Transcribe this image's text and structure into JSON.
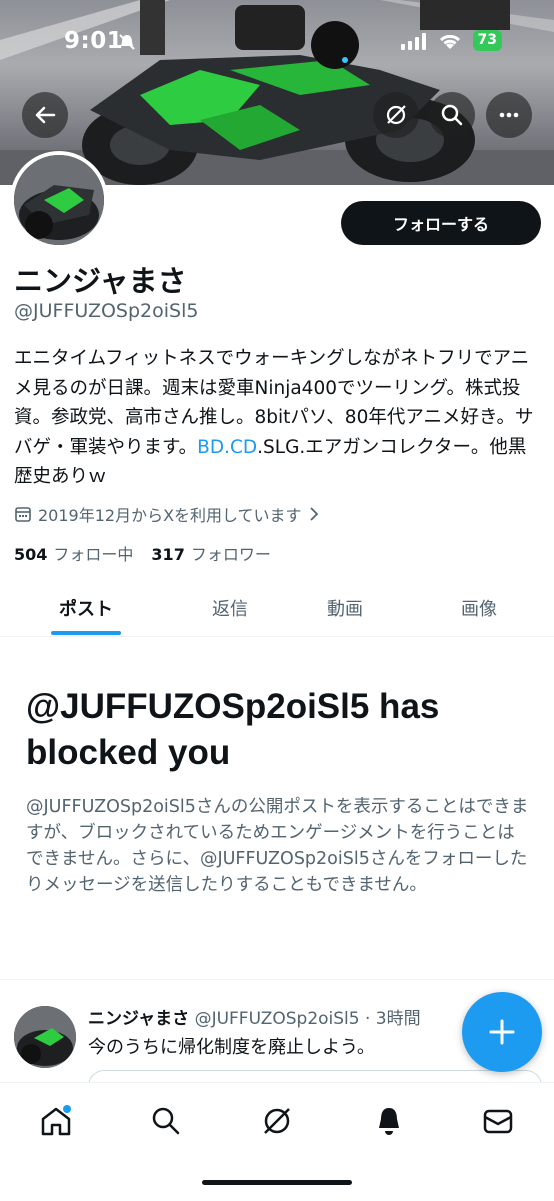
{
  "status_bar": {
    "time": "9:01",
    "battery": "73"
  },
  "header": {
    "back_icon": "arrow-left-icon",
    "grok_icon": "grok-icon",
    "search_icon": "search-icon",
    "more_icon": "more-horizontal-icon"
  },
  "profile": {
    "name": "ニンジャまさ",
    "handle": "@JUFFUZOSp2oiSl5",
    "follow_label": "フォローする",
    "bio_before_link": "エニタイムフィットネスでウォーキングしながネトフリでアニメ見るのが日課。週末は愛車Ninja400でツーリング。株式投資。参政党、高市さん推し。8bitパソ、80年代アニメ好き。サバゲ・軍装やります。",
    "bio_link": "BD.CD",
    "bio_after_link": ".SLG.エアガンコレクター。他黒歴史ありｗ",
    "joined": "2019年12月からXを利用しています",
    "following_count": "504",
    "following_label": "フォロー中",
    "followers_count": "317",
    "followers_label": "フォロワー"
  },
  "tabs": [
    "ポスト",
    "返信",
    "動画",
    "画像"
  ],
  "blocked": {
    "title": "@JUFFUZOSp2oiSl5 has blocked you",
    "description": "@JUFFUZOSp2oiSl5さんの公開ポストを表示することはできますが、ブロックされているためエンゲージメントを行うことはできません。さらに、@JUFFUZOSp2oiSl5さんをフォローしたりメッセージを送信したりすることもできません。"
  },
  "post": {
    "author": "ニンジャまさ",
    "meta": "@JUFFUZOSp2oiSl5 · 3時間",
    "text": "今のうちに帰化制度を廃止しよう。"
  },
  "colors": {
    "accent": "#1d9bf0",
    "text": "#0f1419",
    "secondary": "#536471",
    "battery": "#34c759"
  }
}
